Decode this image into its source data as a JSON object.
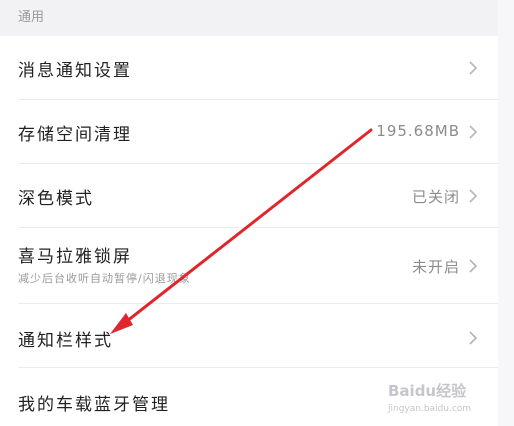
{
  "section": {
    "title": "通用"
  },
  "rows": [
    {
      "label": "消息通知设置",
      "value": ""
    },
    {
      "label": "存储空间清理",
      "value": "195.68MB"
    },
    {
      "label": "深色模式",
      "value": "已关闭"
    },
    {
      "label": "喜马拉雅锁屏",
      "sublabel": "减少后台收听自动暂停/闪退现象",
      "value": "未开启"
    },
    {
      "label": "通知栏样式",
      "value": ""
    },
    {
      "label": "我的车载蓝牙管理",
      "value": ""
    }
  ],
  "watermark": {
    "brand": "Baidu经验",
    "url": "jingyan.baidu.com"
  },
  "colors": {
    "arrow": "#e0262c",
    "chevron": "#b5b5b5"
  },
  "icons": {
    "chevron": "chevron-right-icon",
    "annotation": "red-arrow-annotation"
  }
}
